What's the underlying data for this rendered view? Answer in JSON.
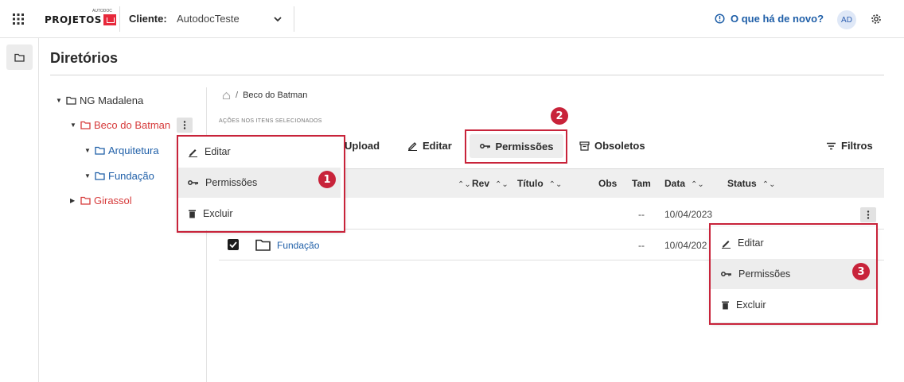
{
  "header": {
    "logo_text": "PROJETOS",
    "logo_superscript": "AUTODOC",
    "client_label": "Cliente:",
    "client_value": "AutodocTeste",
    "whats_new": "O que há de novo?",
    "avatar": "AD"
  },
  "page": {
    "title": "Diretórios"
  },
  "tree": {
    "root": "NG Madalena",
    "selected": "Beco do Batman",
    "children": [
      "Arquitetura",
      "Fundação"
    ],
    "sibling": "Girassol"
  },
  "tree_menu": {
    "edit": "Editar",
    "permissions": "Permissões",
    "delete": "Excluir"
  },
  "breadcrumb": {
    "current": "Beco do Batman"
  },
  "actions_label": "AÇÕES NOS ITENS SELECIONADOS",
  "toolbar": {
    "upload": "Upload",
    "edit": "Editar",
    "permissions": "Permissões",
    "obsolete": "Obsoletos",
    "filters": "Filtros"
  },
  "table": {
    "columns": {
      "rev": "Rev",
      "title": "Título",
      "obs": "Obs",
      "size": "Tam",
      "date": "Data",
      "status": "Status"
    },
    "rows": [
      {
        "name": "",
        "size": "--",
        "date": "10/04/2023"
      },
      {
        "name": "Fundação",
        "size": "--",
        "date": "10/04/202"
      }
    ]
  },
  "row_menu": {
    "edit": "Editar",
    "permissions": "Permissões",
    "delete": "Excluir"
  },
  "badges": [
    "1",
    "2",
    "3"
  ],
  "colors": {
    "accent_red": "#c8233a",
    "link_blue": "#1f5fa8",
    "tree_red": "#d63a3a"
  }
}
